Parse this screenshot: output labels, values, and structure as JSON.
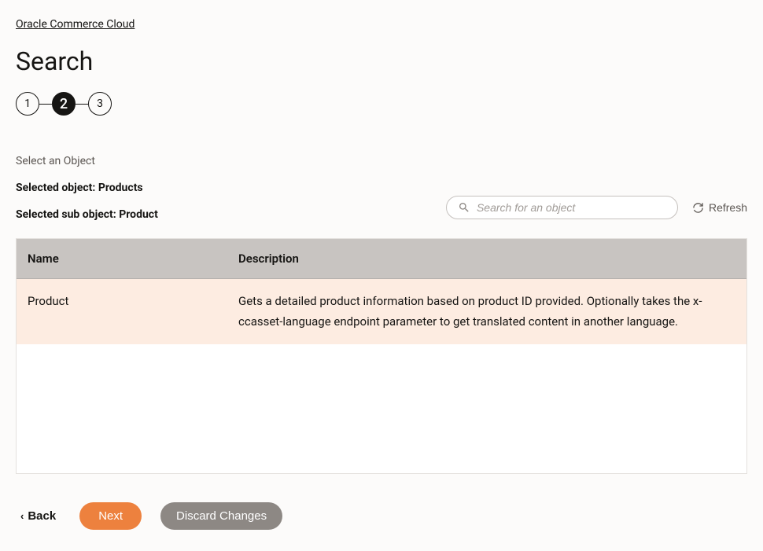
{
  "breadcrumb": {
    "label": "Oracle Commerce Cloud"
  },
  "page": {
    "title": "Search"
  },
  "stepper": {
    "steps": [
      "1",
      "2",
      "3"
    ],
    "active_index": 1
  },
  "section": {
    "label": "Select an Object",
    "selected_object_line": "Selected object: Products",
    "selected_sub_object_line": "Selected sub object: Product"
  },
  "search": {
    "placeholder": "Search for an object"
  },
  "refresh": {
    "label": "Refresh"
  },
  "table": {
    "headers": {
      "name": "Name",
      "description": "Description"
    },
    "rows": [
      {
        "name": "Product",
        "description": "Gets a detailed product information based on product ID provided. Optionally takes the x-ccasset-language endpoint parameter to get translated content in another language."
      }
    ]
  },
  "footer": {
    "back": "Back",
    "next": "Next",
    "discard": "Discard Changes"
  }
}
